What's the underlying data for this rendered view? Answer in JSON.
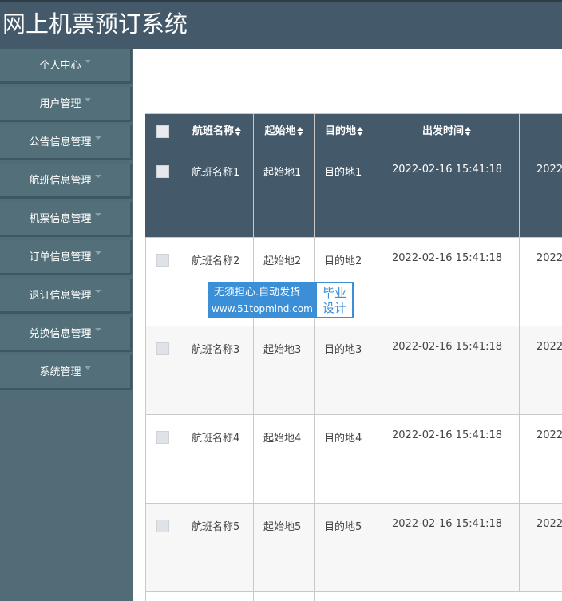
{
  "app": {
    "title": "网上机票预订系统"
  },
  "sidebar": {
    "items": [
      {
        "label": "个人中心"
      },
      {
        "label": "用户管理"
      },
      {
        "label": "公告信息管理"
      },
      {
        "label": "航班信息管理"
      },
      {
        "label": "机票信息管理"
      },
      {
        "label": "订单信息管理"
      },
      {
        "label": "退订信息管理"
      },
      {
        "label": "兑换信息管理"
      },
      {
        "label": "系统管理"
      }
    ]
  },
  "table": {
    "headers": [
      "航班名称",
      "起始地",
      "目的地",
      "出发时间"
    ],
    "rows": [
      {
        "name": "航班名称1",
        "from": "起始地1",
        "to": "目的地1",
        "time": "2022-02-16 15:41:18",
        "next": "2022"
      },
      {
        "name": "航班名称2",
        "from": "起始地2",
        "to": "目的地2",
        "time": "2022-02-16 15:41:18",
        "next": "2022"
      },
      {
        "name": "航班名称3",
        "from": "起始地3",
        "to": "目的地3",
        "time": "2022-02-16 15:41:18",
        "next": "2022"
      },
      {
        "name": "航班名称4",
        "from": "起始地4",
        "to": "目的地4",
        "time": "2022-02-16 15:41:18",
        "next": "2022"
      },
      {
        "name": "航班名称5",
        "from": "起始地5",
        "to": "目的地5",
        "time": "2022-02-16 15:41:18",
        "next": "2022"
      }
    ]
  },
  "watermark": {
    "line1": "无须担心.自动发货",
    "line2": "www.51topmind.com",
    "right1": "毕业",
    "right2": "设计"
  },
  "colors": {
    "header": "#44596a",
    "sidebar": "#536f7a",
    "row_hover": "#44596a",
    "watermark": "#3b8fd7"
  }
}
